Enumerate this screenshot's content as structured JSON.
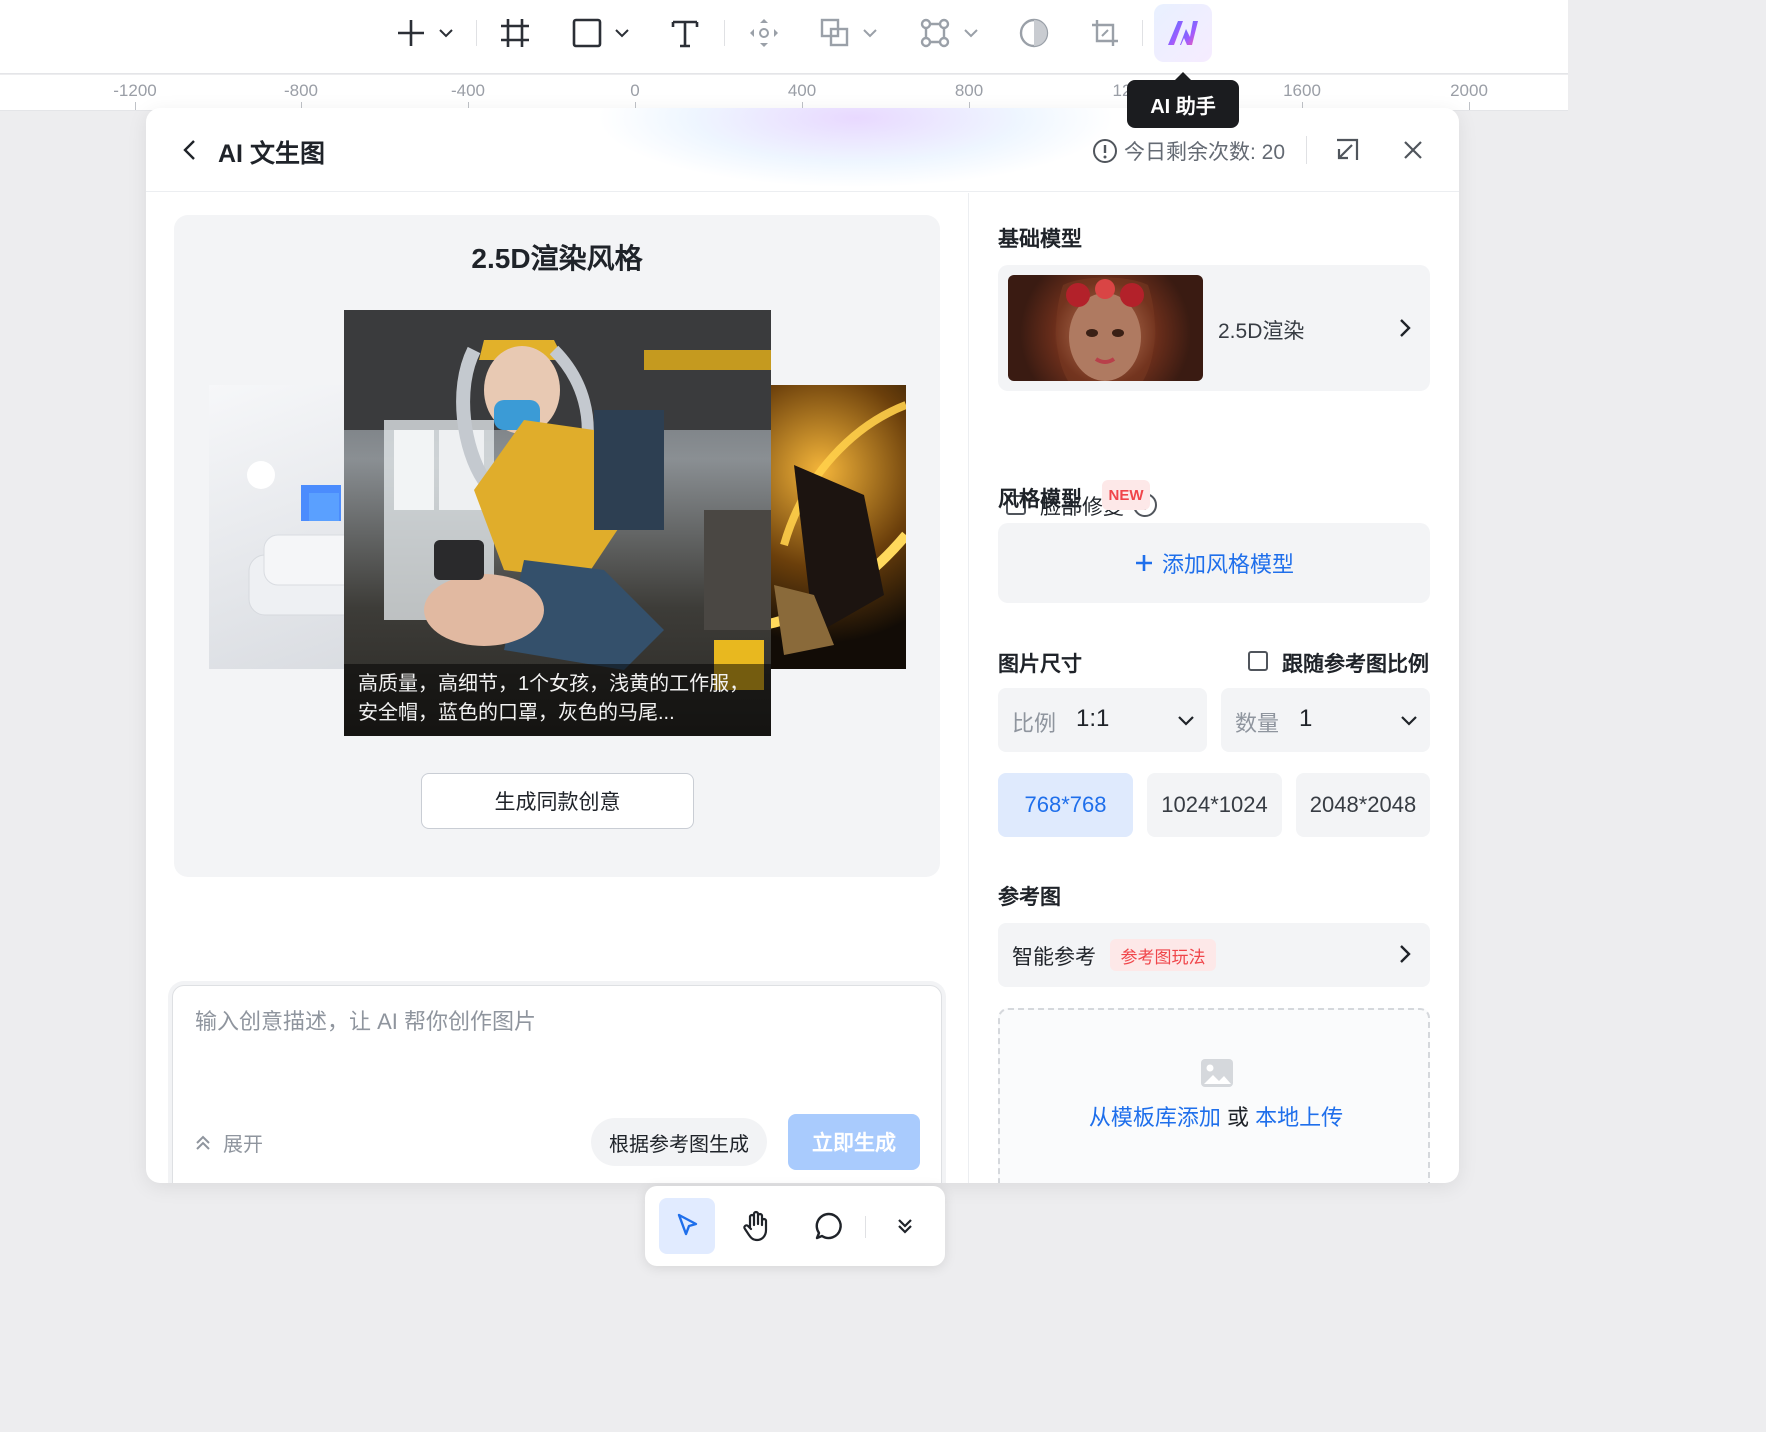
{
  "toolbar": {
    "tooltip": "AI 助手",
    "icons": [
      "add-icon",
      "frame-icon",
      "rectangle-icon",
      "text-icon",
      "component-icon",
      "boolean-icon",
      "vector-icon",
      "mask-icon",
      "crop-icon",
      "ai-assistant-icon"
    ]
  },
  "ruler": {
    "ticks": [
      "-1200",
      "-800",
      "-400",
      "0",
      "400",
      "800",
      "12",
      "1600",
      "2000"
    ]
  },
  "panel": {
    "title": "AI 文生图",
    "quota": "今日剩余次数: 20"
  },
  "showcase": {
    "title": "2.5D渲染风格",
    "caption": "高质量，高细节，1个女孩，浅黄的工作服，安全帽，蓝色的口罩，灰色的马尾...",
    "button": "生成同款创意"
  },
  "prompt": {
    "placeholder": "输入创意描述，让 AI 帮你创作图片",
    "expand": "展开",
    "ref_generate": "根据参考图生成",
    "generate_now": "立即生成"
  },
  "settings": {
    "base_model_label": "基础模型",
    "base_model_name": "2.5D渲染",
    "face_fix": "脸部修复",
    "style_model_label": "风格模型",
    "new_badge": "NEW",
    "add_style": "添加风格模型",
    "size_label": "图片尺寸",
    "follow_ratio": "跟随参考图比例",
    "ratio_label": "比例",
    "ratio_value": "1:1",
    "count_label": "数量",
    "count_value": "1",
    "sizes": [
      "768*768",
      "1024*1024",
      "2048*2048"
    ],
    "ref_label": "参考图",
    "smart_ref": "智能参考",
    "ref_badge": "参考图玩法",
    "upload_from": "从模板库添加",
    "upload_or": "或",
    "upload_local": "本地上传"
  },
  "colors": {
    "accent": "#1f6feb",
    "generate_disabled": "#a9cbfd",
    "badge_red": "#f0454a"
  }
}
